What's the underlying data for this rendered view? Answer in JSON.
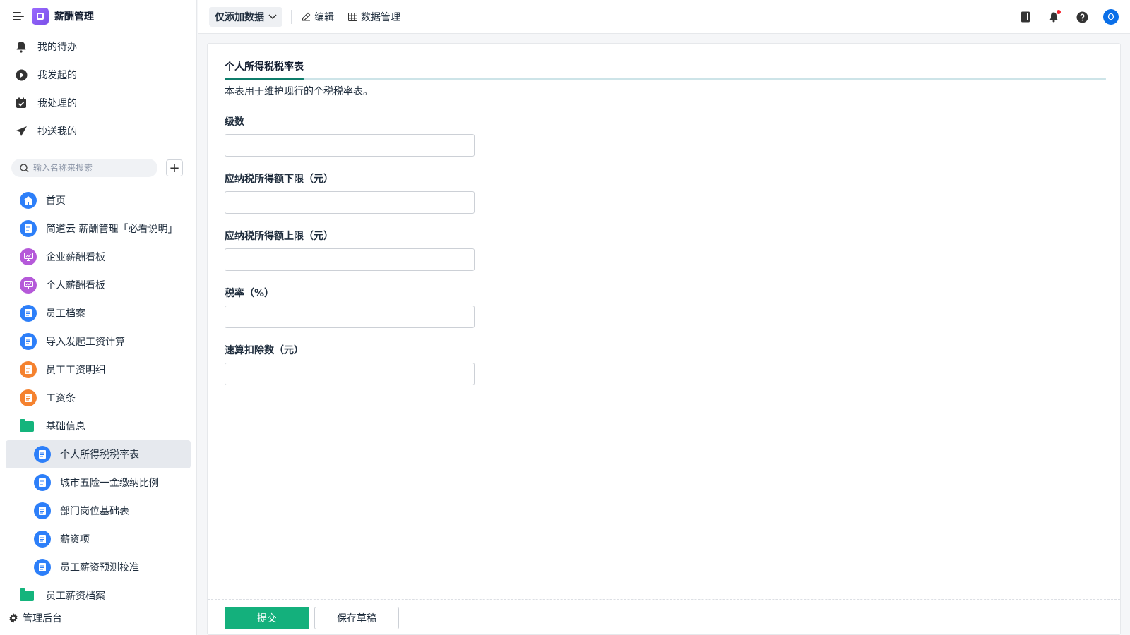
{
  "app": {
    "title": "薪酬管理"
  },
  "quick_links": [
    {
      "label": "我的待办",
      "icon": "bell-icon"
    },
    {
      "label": "我发起的",
      "icon": "play-circle-icon"
    },
    {
      "label": "我处理的",
      "icon": "calendar-check-icon"
    },
    {
      "label": "抄送我的",
      "icon": "send-icon"
    }
  ],
  "search": {
    "placeholder": "输入名称来搜索"
  },
  "nav": [
    {
      "label": "首页",
      "icon": "home-icon",
      "color": "#2d7ff9"
    },
    {
      "label": "简道云 薪酬管理「必看说明」",
      "icon": "document-icon",
      "color": "#2d7ff9"
    },
    {
      "label": "企业薪酬看板",
      "icon": "dashboard-icon",
      "color": "#b559d9"
    },
    {
      "label": "个人薪酬看板",
      "icon": "dashboard-icon",
      "color": "#b559d9"
    },
    {
      "label": "员工档案",
      "icon": "document-icon",
      "color": "#2d7ff9"
    },
    {
      "label": "导入发起工资计算",
      "icon": "document-icon",
      "color": "#2d7ff9"
    },
    {
      "label": "员工工资明细",
      "icon": "document-icon",
      "color": "#f5822f"
    },
    {
      "label": "工资条",
      "icon": "document-icon",
      "color": "#f5822f"
    },
    {
      "label": "基础信息",
      "icon": "folder-icon",
      "color": "#14b47c"
    },
    {
      "label": "个人所得税税率表",
      "icon": "document-icon",
      "color": "#2d7ff9"
    },
    {
      "label": "城市五险一金缴纳比例",
      "icon": "document-icon",
      "color": "#2d7ff9"
    },
    {
      "label": "部门岗位基础表",
      "icon": "document-icon",
      "color": "#2d7ff9"
    },
    {
      "label": "薪资项",
      "icon": "document-icon",
      "color": "#2d7ff9"
    },
    {
      "label": "员工薪资预测校准",
      "icon": "document-icon",
      "color": "#2d7ff9"
    },
    {
      "label": "员工薪资档案",
      "icon": "folder-icon",
      "color": "#14b47c"
    }
  ],
  "footer": {
    "label": "管理后台"
  },
  "toolbar": {
    "mode": "仅添加数据",
    "edit": "编辑",
    "data_manage": "数据管理",
    "avatar_letter": "O"
  },
  "form": {
    "title": "个人所得税税率表",
    "description": "本表用于维护现行的个税税率表。",
    "fields": [
      {
        "label": "级数",
        "value": ""
      },
      {
        "label": "应纳税所得额下限（元）",
        "value": ""
      },
      {
        "label": "应纳税所得额上限（元）",
        "value": ""
      },
      {
        "label": "税率（%）",
        "value": ""
      },
      {
        "label": "速算扣除数（元）",
        "value": ""
      }
    ],
    "submit": "提交",
    "save_draft": "保存草稿"
  },
  "colors": {
    "accent": "#14b07c",
    "primary_blue": "#2d7ff9"
  }
}
